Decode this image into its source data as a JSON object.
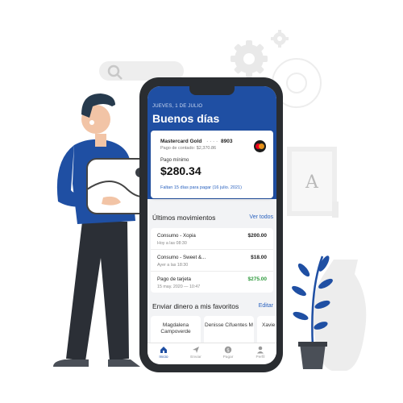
{
  "app": {
    "date": "JUEVES, 1 DE JULIO",
    "greeting": "Buenos días",
    "accent_color": "#1f4fa3",
    "positive_color": "#2e9a3c"
  },
  "card": {
    "name": "Mastercard Gold",
    "mask": "· · · ·",
    "last4": "8903",
    "cash_payment": "Pago de contado: $2,370.86",
    "min_label": "Pago mínimo",
    "min_amount": "$280.34",
    "note": "Faltan 15 días para pagar (16 julio. 2021)",
    "brand_icon": "mastercard-icon"
  },
  "movements": {
    "title": "Últimos movimientos",
    "link": "Ver todos",
    "items": [
      {
        "title": "Consumo - Xopia",
        "date": "Hoy a las 08:30",
        "amount": "$200.00"
      },
      {
        "title": "Consumo - Sweet &...",
        "date": "Ayer a las 18:30",
        "amount": "$18.00"
      },
      {
        "title": "Pago de tarjeta",
        "date": "15 may. 2020 — 10:47",
        "amount": "$275.00"
      }
    ]
  },
  "favorites": {
    "title": "Enviar dinero a mis favoritos",
    "link": "Editar",
    "items": [
      {
        "name": "Magdalena Campoverde"
      },
      {
        "name": "Denisse Cifuentes M"
      },
      {
        "name": "Xavie Duqu"
      }
    ]
  },
  "tabs": [
    {
      "label": "Inicio",
      "icon": "home-icon"
    },
    {
      "label": "Enviar",
      "icon": "send-icon"
    },
    {
      "label": "Pagar",
      "icon": "pay-icon"
    },
    {
      "label": "Perfil",
      "icon": "profile-icon"
    }
  ]
}
